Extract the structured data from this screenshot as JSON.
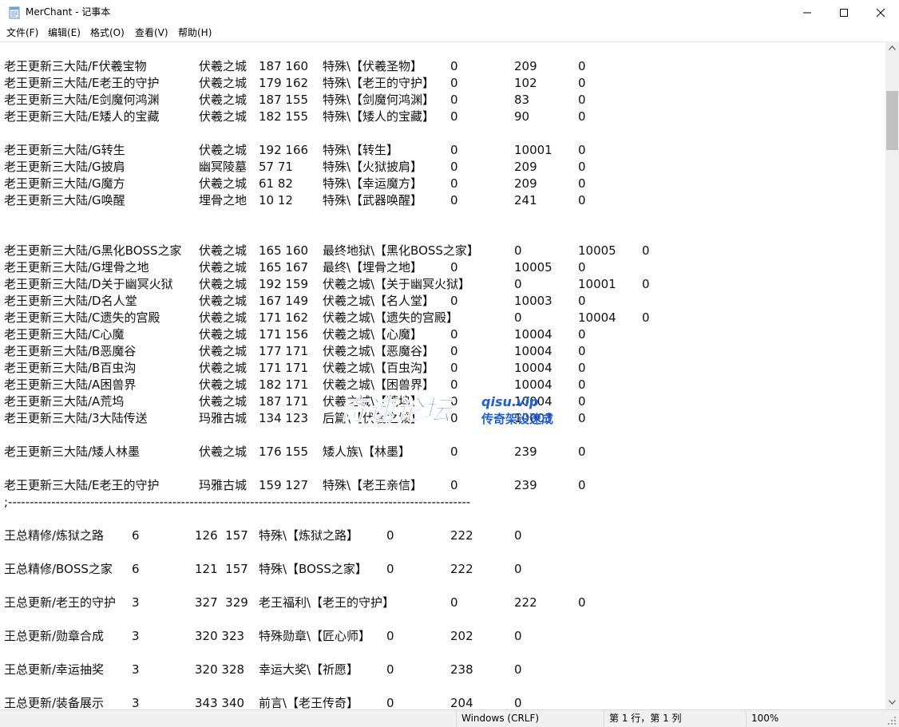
{
  "window": {
    "title": "MerChant - 记事本"
  },
  "menu": [
    "文件(F)",
    "编辑(E)",
    "格式(O)",
    "查看(V)",
    "帮助(H)"
  ],
  "lines": [
    [
      "老王更新三大陆/F伏羲宝物",
      "伏羲之城",
      "187 160",
      "特殊\\【伏羲圣物】",
      "0",
      "209",
      "0"
    ],
    [
      "老王更新三大陆/E老王的守护",
      "伏羲之城",
      "179 162",
      "特殊\\【老王的守护】",
      "0",
      "102",
      "0"
    ],
    [
      "老王更新三大陆/E剑魔何鸿渊",
      "伏羲之城",
      "187 155",
      "特殊\\【剑魔何鸿渊】",
      "0",
      "83",
      "0"
    ],
    [
      "老王更新三大陆/E矮人的宝藏",
      "伏羲之城",
      "182 155",
      "特殊\\【矮人的宝藏】",
      "0",
      "90",
      "0"
    ],
    [],
    [
      "老王更新三大陆/G转生",
      "伏羲之城",
      "192 166",
      "特殊\\【转生】",
      "0",
      "10001",
      "0"
    ],
    [
      "老王更新三大陆/G披肩",
      "幽冥陵墓",
      "57 71",
      "特殊\\【火狱披肩】",
      "0",
      "209",
      "0"
    ],
    [
      "老王更新三大陆/G魔方",
      "伏羲之城",
      "61 82",
      "特殊\\【幸运魔方】",
      "0",
      "209",
      "0"
    ],
    [
      "老王更新三大陆/G唤醒",
      "埋骨之地",
      "10 12",
      "特殊\\【武器唤醒】",
      "0",
      "241",
      "0"
    ],
    [],
    [],
    [
      "老王更新三大陆/G黑化BOSS之家",
      "伏羲之城",
      "165 160",
      "最终地狱\\【黑化BOSS之家】",
      "",
      "0",
      "10005",
      "0"
    ],
    [
      "老王更新三大陆/G埋骨之地",
      "伏羲之城",
      "165 167",
      "最终\\【埋骨之地】",
      "0",
      "10005",
      "0"
    ],
    [
      "老王更新三大陆/D关于幽冥火狱",
      "伏羲之城",
      "192 159",
      "伏羲之城\\【关于幽冥火狱】",
      "",
      "0",
      "10001",
      "0"
    ],
    [
      "老王更新三大陆/D名人堂",
      "伏羲之城",
      "167 149",
      "伏羲之城\\【名人堂】",
      "0",
      "10003",
      "0"
    ],
    [
      "老王更新三大陆/C遗失的宫殿",
      "伏羲之城",
      "171 162",
      "伏羲之城\\【遗失的宫殿】",
      "",
      "0",
      "10004",
      "0"
    ],
    [
      "老王更新三大陆/C心魔",
      "伏羲之城",
      "171 156",
      "伏羲之城\\【心魔】",
      "0",
      "10004",
      "0"
    ],
    [
      "老王更新三大陆/B恶魔谷",
      "伏羲之城",
      "177 171",
      "伏羲之城\\【恶魔谷】",
      "0",
      "10004",
      "0"
    ],
    [
      "老王更新三大陆/B百虫沟",
      "伏羲之城",
      "171 171",
      "伏羲之城\\【百虫沟】",
      "0",
      "10004",
      "0"
    ],
    [
      "老王更新三大陆/A困兽界",
      "伏羲之城",
      "182 171",
      "伏羲之城\\【困兽界】",
      "0",
      "10004",
      "0"
    ],
    [
      "老王更新三大陆/A荒坞",
      "伏羲之城",
      "187 171",
      "伏羲之城\\【荒坞】",
      "0",
      "10004",
      "0"
    ],
    [
      "老王更新三大陆/3大陆传送",
      "玛雅古城",
      "134 123",
      "后篇\\【伏羲之城】",
      "0",
      "10003",
      "0"
    ],
    [],
    [
      "老王更新三大陆/矮人林墨",
      "伏羲之城",
      "176 155",
      "矮人族\\【林墨】",
      "0",
      "239",
      "0"
    ],
    [],
    [
      "老王更新三大陆/E老王的守护",
      "玛雅古城",
      "159 127",
      "特殊\\【老王亲信】",
      "0",
      "239",
      "0"
    ],
    [
      ";-----------------------------------------------------------------------------------------------------------"
    ],
    [],
    [
      "王总精修/炼狱之路",
      "6",
      "126  157",
      "特殊\\【炼狱之路】",
      "0",
      "222",
      "0"
    ],
    [],
    [
      "王总精修/BOSS之家",
      "6",
      "121  157",
      "特殊\\【BOSS之家】",
      "0",
      "222",
      "0"
    ],
    [],
    [
      "王总更新/老王的守护",
      "3",
      "327  329",
      "老王福利\\【老王的守护】",
      "",
      "0",
      "222",
      "0"
    ],
    [],
    [
      "王总更新/勋章合成",
      "3",
      "320 323",
      "特殊勋章\\【匠心师】",
      "0",
      "202",
      "0"
    ],
    [],
    [
      "王总更新/幸运抽奖",
      "3",
      "320 328",
      "幸运大奖\\【祈愿】",
      "0",
      "238",
      "0"
    ],
    [],
    [
      "王总更新/装备展示",
      "3",
      "343 340",
      "前言\\【老王传奇】",
      "0",
      "204",
      "0"
    ]
  ],
  "watermark": {
    "main": "奇速论坛",
    "domain": "qisu.vip",
    "slogan": "传奇架设速成"
  },
  "status": {
    "line_ending": "Windows (CRLF)",
    "position": "第 1 行，第 1 列",
    "zoom": "100%"
  },
  "colors": {
    "watermark": "#1c5fe0",
    "statusbar": "#f0f0f0",
    "scroll_thumb": "#c1c1c1"
  }
}
